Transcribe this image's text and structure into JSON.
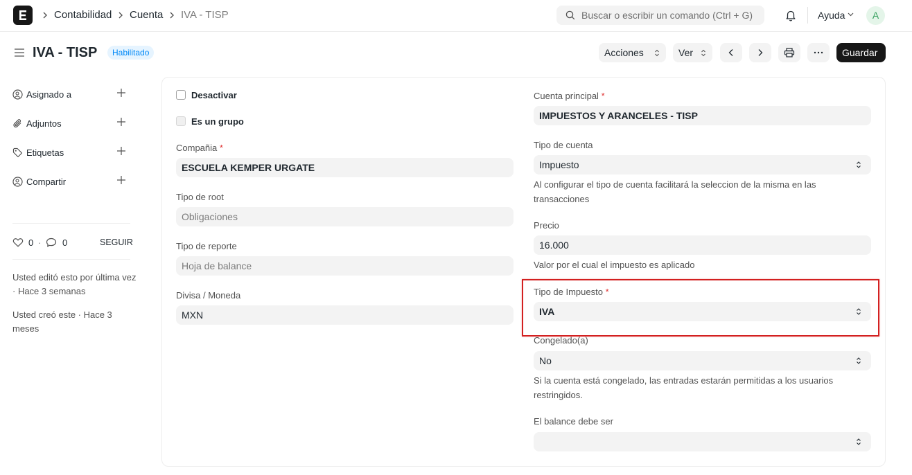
{
  "navbar": {
    "breadcrumbs": [
      "Contabilidad",
      "Cuenta",
      "IVA - TISP"
    ],
    "search_placeholder": "Buscar o escribir un comando (Ctrl + G)",
    "help_label": "Ayuda",
    "avatar_initial": "A"
  },
  "header": {
    "title": "IVA - TISP",
    "status": "Habilitado",
    "actions_label": "Acciones",
    "view_label": "Ver",
    "save_label": "Guardar"
  },
  "sidebar": {
    "items": [
      {
        "label": "Asignado a"
      },
      {
        "label": "Adjuntos"
      },
      {
        "label": "Etiquetas"
      },
      {
        "label": "Compartir"
      }
    ],
    "likes_count": "0",
    "comments_count": "0",
    "follow_label": "SEGUIR",
    "modified_note": "Usted editó esto por última vez · Hace 3 semanas",
    "created_note": "Usted creó este · Hace 3 meses"
  },
  "form": {
    "disable_label": "Desactivar",
    "is_group_label": "Es un grupo",
    "company": {
      "label": "Compañia",
      "value": "ESCUELA KEMPER URGATE"
    },
    "root_type": {
      "label": "Tipo de root",
      "value": "Obligaciones"
    },
    "report_type": {
      "label": "Tipo de reporte",
      "value": "Hoja de balance"
    },
    "currency": {
      "label": "Divisa / Moneda",
      "value": "MXN"
    },
    "parent_account": {
      "label": "Cuenta principal",
      "value": "IMPUESTOS Y ARANCELES - TISP"
    },
    "account_type": {
      "label": "Tipo de cuenta",
      "value": "Impuesto",
      "description": "Al configurar el tipo de cuenta facilitará la seleccion de la misma en las transacciones"
    },
    "rate": {
      "label": "Precio",
      "value": "16.000",
      "description": "Valor por el cual el impuesto es aplicado"
    },
    "tax_type": {
      "label": "Tipo de Impuesto",
      "value": "IVA"
    },
    "frozen": {
      "label": "Congelado(a)",
      "value": "No",
      "description": "Si la cuenta está congelado, las entradas estarán permitidas a los usuarios restringidos."
    },
    "balance_must_be": {
      "label": "El balance debe ser",
      "value": ""
    }
  },
  "colors": {
    "primary_button": "#171717",
    "badge_bg": "#e6f4ff",
    "badge_text": "#0289f7",
    "required": "#e03636",
    "highlight": "#d32020"
  }
}
